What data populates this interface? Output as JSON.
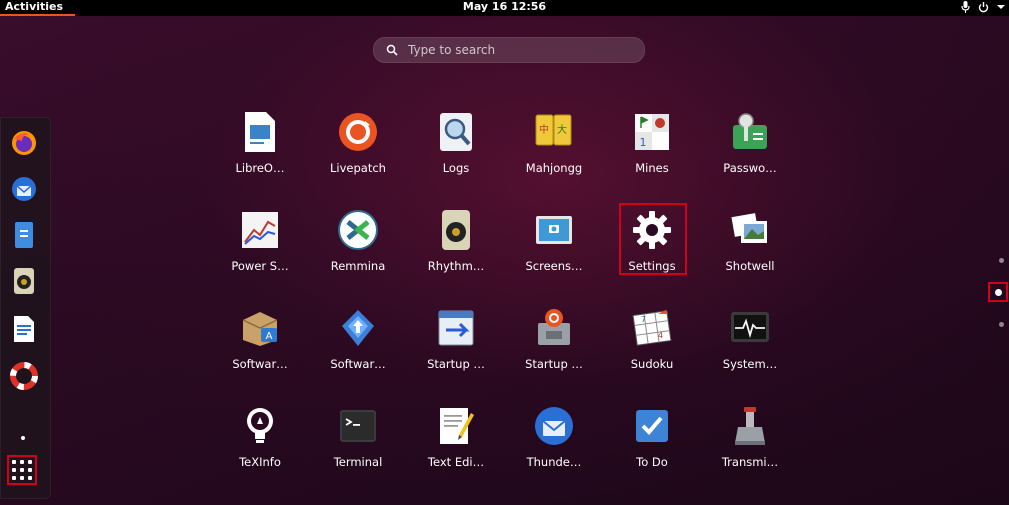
{
  "topbar": {
    "activities": "Activities",
    "clock": "May 16  12:56"
  },
  "search": {
    "placeholder": "Type to search"
  },
  "dock": {
    "items": [
      {
        "name": "firefox-icon"
      },
      {
        "name": "thunderbird-icon"
      },
      {
        "name": "files-icon"
      },
      {
        "name": "rhythmbox-icon"
      },
      {
        "name": "libreoffice-writer-icon"
      },
      {
        "name": "help-icon"
      }
    ]
  },
  "apps": [
    {
      "label": "LibreO…",
      "icon": "libreoffice-draw-icon"
    },
    {
      "label": "Livepatch",
      "icon": "livepatch-icon"
    },
    {
      "label": "Logs",
      "icon": "logs-icon"
    },
    {
      "label": "Mahjongg",
      "icon": "mahjongg-icon"
    },
    {
      "label": "Mines",
      "icon": "mines-icon"
    },
    {
      "label": "Passwo…",
      "icon": "passwords-icon"
    },
    {
      "label": "Power S…",
      "icon": "power-statistics-icon"
    },
    {
      "label": "Remmina",
      "icon": "remmina-icon"
    },
    {
      "label": "Rhythm…",
      "icon": "rhythmbox-icon"
    },
    {
      "label": "Screens…",
      "icon": "screenshot-icon"
    },
    {
      "label": "Settings",
      "icon": "settings-icon"
    },
    {
      "label": "Shotwell",
      "icon": "shotwell-icon"
    },
    {
      "label": "Softwar…",
      "icon": "software-icon"
    },
    {
      "label": "Softwar…",
      "icon": "software-updater-icon"
    },
    {
      "label": "Startup …",
      "icon": "startup-applications-icon"
    },
    {
      "label": "Startup …",
      "icon": "startup-disk-creator-icon"
    },
    {
      "label": "Sudoku",
      "icon": "sudoku-icon"
    },
    {
      "label": "System…",
      "icon": "system-monitor-icon"
    },
    {
      "label": "TeXInfo",
      "icon": "texinfo-icon"
    },
    {
      "label": "Terminal",
      "icon": "terminal-icon"
    },
    {
      "label": "Text Edi…",
      "icon": "text-editor-icon"
    },
    {
      "label": "Thunde…",
      "icon": "thunderbird-icon"
    },
    {
      "label": "To Do",
      "icon": "todo-icon"
    },
    {
      "label": "Transmi…",
      "icon": "transmission-icon"
    }
  ],
  "pages": {
    "count": 3,
    "current": 2
  }
}
